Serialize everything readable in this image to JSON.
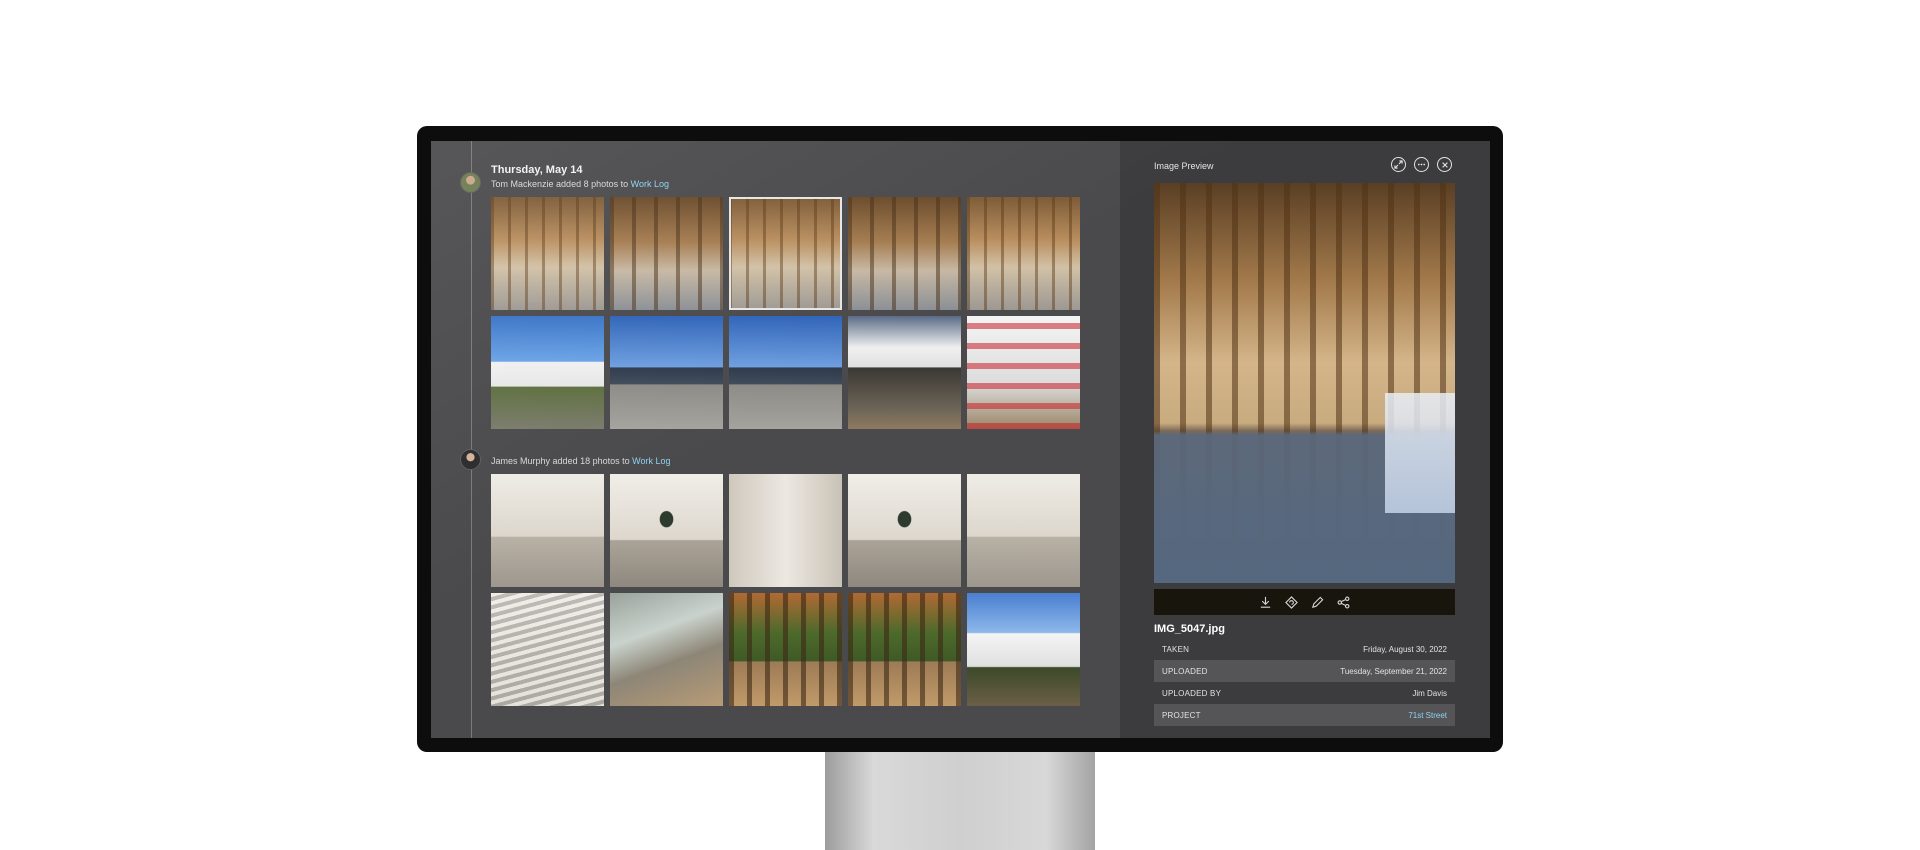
{
  "feed": {
    "date_heading": "Thursday, May 14",
    "entries": [
      {
        "user": "Tom Mackenzie",
        "action": "added 8 photos to",
        "target": "Work Log",
        "photos": [
          "framing-1",
          "framing-2",
          "framing-3",
          "framing-4",
          "framing-5",
          "exterior-1",
          "exterior-2",
          "exterior-3",
          "garage",
          "wrap"
        ]
      },
      {
        "user": "James Murphy",
        "action": "added 18 photos to",
        "target": "Work Log",
        "photos": [
          "room-stairs",
          "room-windows",
          "room-window",
          "room-three-windows",
          "room-doorway",
          "room-lumber",
          "glass-panels",
          "porch-1",
          "porch-2",
          "house-exterior"
        ]
      }
    ]
  },
  "preview": {
    "title": "Image Preview",
    "filename": "IMG_5047.jpg",
    "icons": [
      "expand-icon",
      "more-icon",
      "close-icon"
    ],
    "toolbar_icons": [
      "download-icon",
      "rotate-icon",
      "edit-icon",
      "share-icon"
    ],
    "details": [
      {
        "label": "TAKEN",
        "value": "Friday, August 30, 2022"
      },
      {
        "label": "UPLOADED",
        "value": "Tuesday, September 21, 2022"
      },
      {
        "label": "UPLOADED BY",
        "value": "Jim Davis"
      },
      {
        "label": "PROJECT",
        "value": "71st Street"
      }
    ]
  },
  "colors": {
    "link": "#8fd2f0",
    "panel_bg": "#4a4a4c",
    "preview_bg": "#3c3c3e"
  }
}
